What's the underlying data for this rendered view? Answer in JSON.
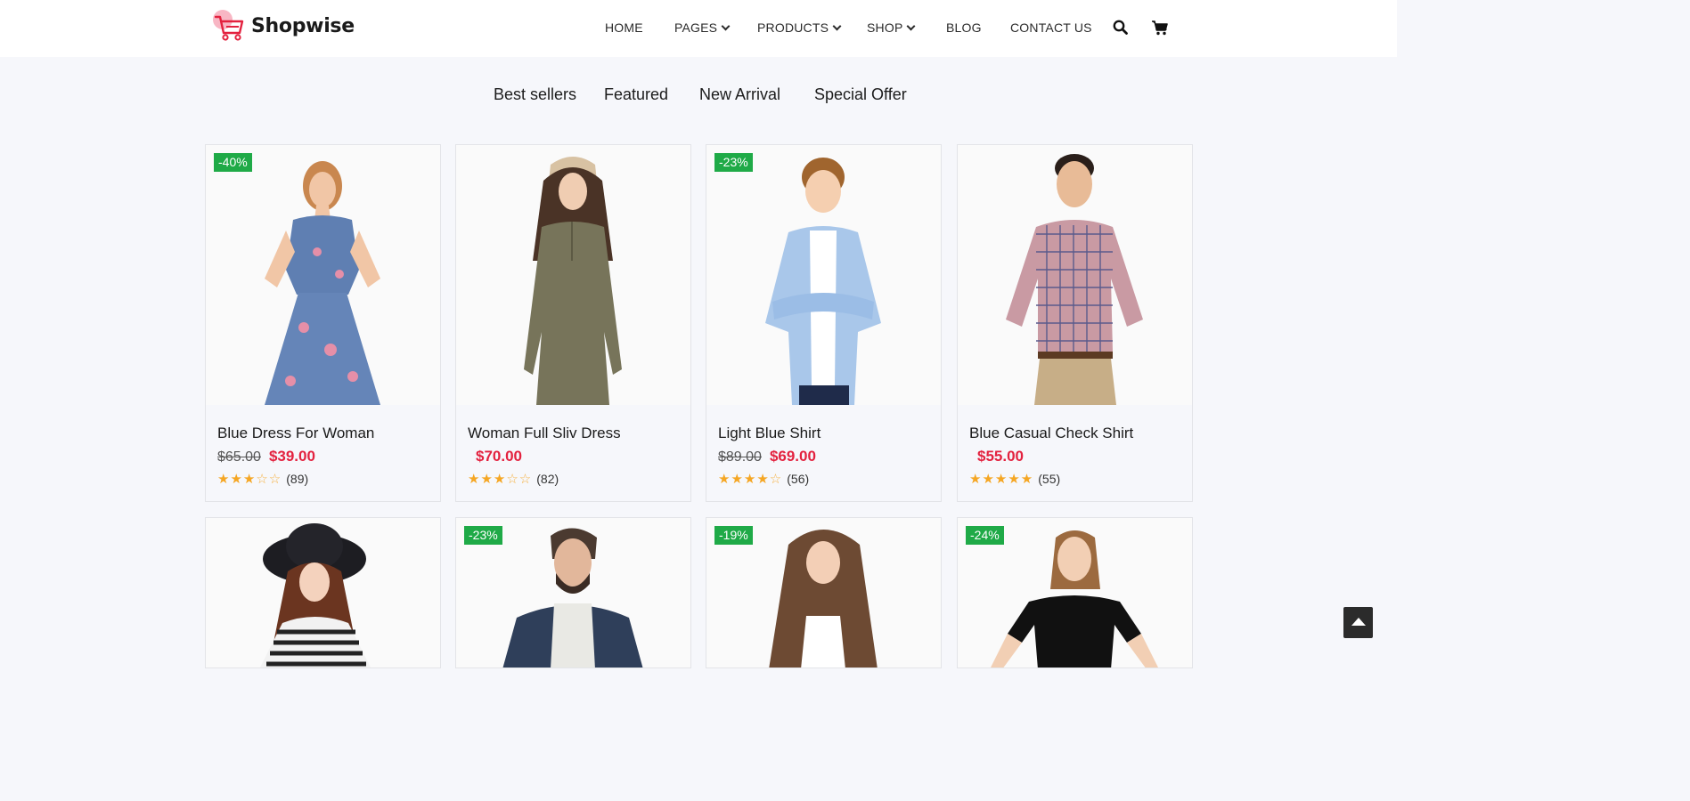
{
  "brand": {
    "name": "Shopwise",
    "accent": "#e3223f",
    "badge_color": "#1faa47"
  },
  "nav": {
    "items": [
      {
        "label": "HOME",
        "dropdown": false
      },
      {
        "label": "PAGES",
        "dropdown": true
      },
      {
        "label": "PRODUCTS",
        "dropdown": true
      },
      {
        "label": "SHOP",
        "dropdown": true
      },
      {
        "label": "BLOG",
        "dropdown": false
      },
      {
        "label": "CONTACT US",
        "dropdown": false
      }
    ],
    "icons": [
      "search-icon",
      "cart-icon"
    ]
  },
  "tabs": [
    "Best sellers",
    "Featured",
    "New Arrival",
    "Special Offer"
  ],
  "products": [
    {
      "badge": "-40%",
      "name": "Blue Dress For Woman",
      "old_price": "$65.00",
      "price": "$39.00",
      "rating": 3,
      "reviews": "(89)"
    },
    {
      "badge": "",
      "name": "Woman Full Sliv Dress",
      "old_price": "",
      "price": "$70.00",
      "rating": 3,
      "reviews": "(82)"
    },
    {
      "badge": "-23%",
      "name": "Light Blue Shirt",
      "old_price": "$89.00",
      "price": "$69.00",
      "rating": 4,
      "reviews": "(56)"
    },
    {
      "badge": "",
      "name": "Blue Casual Check Shirt",
      "old_price": "",
      "price": "$55.00",
      "rating": 5,
      "reviews": "(55)"
    },
    {
      "badge": ""
    },
    {
      "badge": "-23%"
    },
    {
      "badge": "-19%"
    },
    {
      "badge": "-24%"
    }
  ],
  "scroll_top_icon": "arrow-up-icon"
}
